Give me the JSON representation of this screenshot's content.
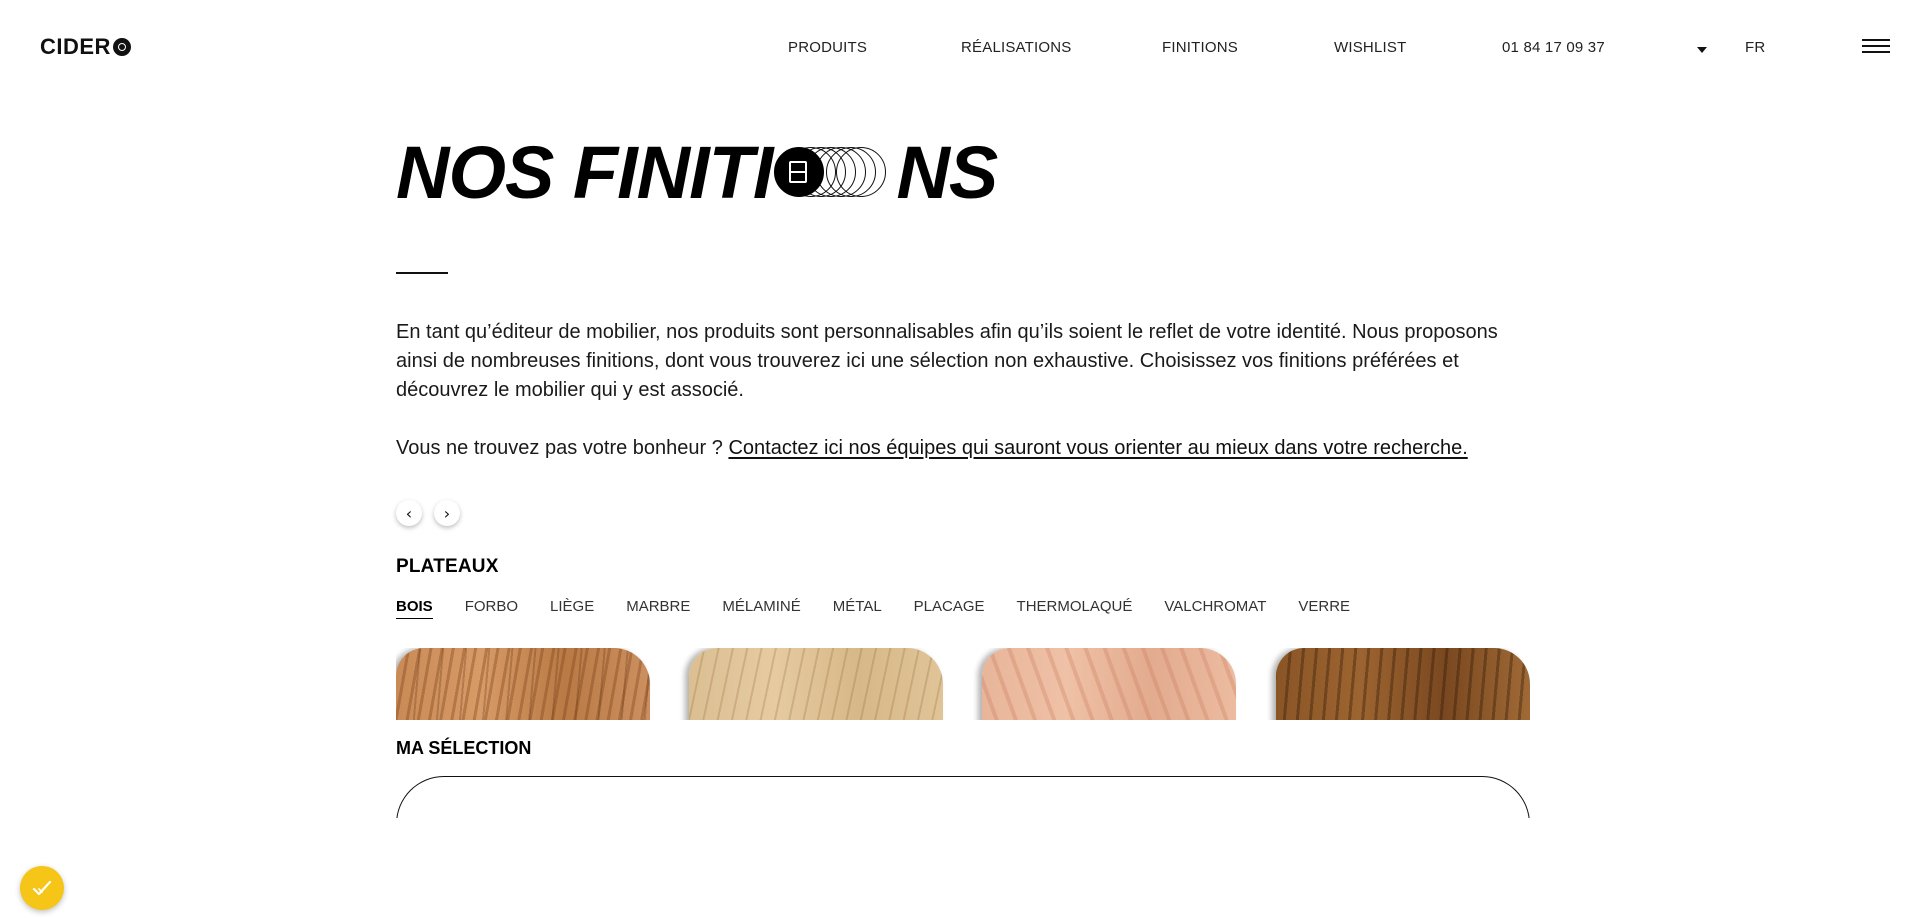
{
  "header": {
    "logo_text": "CIDER",
    "nav": {
      "produits": "PRODUITS",
      "realisations": "RÉALISATIONS",
      "finitions": "FINITIONS",
      "wishlist": "WISHLIST",
      "phone": "01 84 17 09 37",
      "lang": "FR"
    }
  },
  "hero": {
    "title_before": "NOS FINITI",
    "title_after": "NS",
    "intro": "En tant qu’éditeur de mobilier, nos produits sont personnalisables afin qu’ils soient le reflet de votre identité. Nous proposons ainsi de nombreuses finitions, dont vous trouverez ici une sélection non exhaustive. Choisissez vos finitions préférées et découvrez le mobilier qui y est associé.",
    "contact_prefix": "Vous ne trouvez pas votre bonheur ? ",
    "contact_link": "Contactez ici nos équipes qui sauront vous orienter au mieux dans votre recherche."
  },
  "carousel": {
    "prev_icon": "chevron-left-icon",
    "next_icon": "chevron-right-icon",
    "prev_glyph": "‹",
    "next_glyph": "›"
  },
  "plateaux": {
    "title": "PLATEAUX",
    "tabs": [
      "BOIS",
      "FORBO",
      "LIÈGE",
      "MARBRE",
      "MÉLAMINÉ",
      "MÉTAL",
      "PLACAGE",
      "THERMOLAQUÉ",
      "VALCHROMAT",
      "VERRE"
    ],
    "active_tab": "BOIS"
  },
  "selection": {
    "title": "MA SÉLECTION"
  },
  "colors": {
    "text": "#111111",
    "background": "#ffffff",
    "cookie": "#f5c518"
  }
}
